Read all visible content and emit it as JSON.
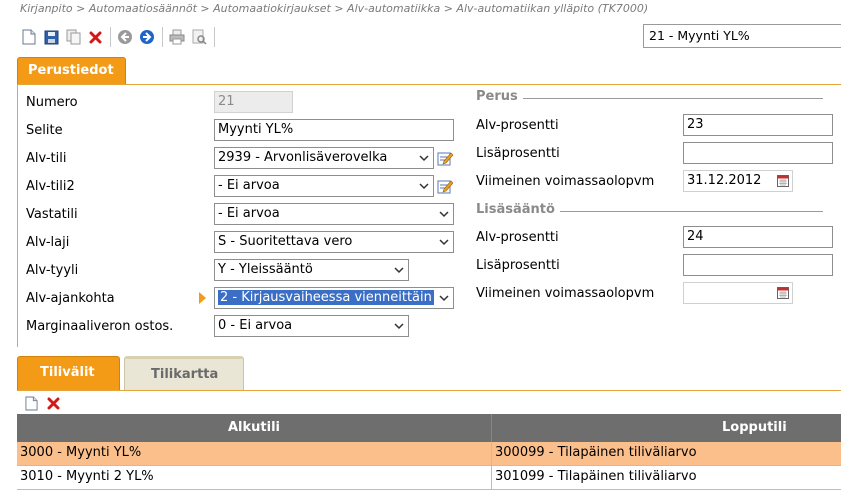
{
  "breadcrumb": "Kirjanpito > Automaatiosäännöt > Automaatiokirjaukset > Alv-automatiikka > Alv-automatiikan ylläpito  (TK7000)",
  "toolbar": {
    "icons": [
      "new-document-icon",
      "save-icon",
      "copy-icon",
      "delete-icon",
      "back-icon",
      "forward-icon",
      "print-icon",
      "print-preview-icon"
    ]
  },
  "record_selector": "21 - Myynti YL%",
  "tabs": {
    "main": "Perustiedot",
    "lower": [
      "Tilivälit",
      "Tilikartta"
    ]
  },
  "form": {
    "numero": {
      "label": "Numero",
      "value": "21"
    },
    "selite": {
      "label": "Selite",
      "value": "Myynti YL%"
    },
    "alv_tili": {
      "label": "Alv-tili",
      "value": "2939 - Arvonlisäverovelka"
    },
    "alv_tili2": {
      "label": "Alv-tili2",
      "value": "-  Ei arvoa"
    },
    "vastatili": {
      "label": "Vastatili",
      "value": "-  Ei arvoa"
    },
    "alv_laji": {
      "label": "Alv-laji",
      "value": "S - Suoritettava vero"
    },
    "alv_tyyli": {
      "label": "Alv-tyyli",
      "value": "Y - Yleissääntö"
    },
    "alv_ajankohta": {
      "label": "Alv-ajankohta",
      "value": "2 - Kirjausvaiheessa vienneittäin"
    },
    "marginaali": {
      "label": "Marginaaliveron ostos.",
      "value": "0 - Ei arvoa"
    }
  },
  "perus": {
    "title": "Perus",
    "alv_prosentti": {
      "label": "Alv-prosentti",
      "value": "23"
    },
    "lisaprosentti": {
      "label": "Lisäprosentti",
      "value": ""
    },
    "voimassaolo": {
      "label": "Viimeinen voimassaolopvm",
      "value": "31.12.2012"
    }
  },
  "lisasaanto": {
    "title": "Lisäsääntö",
    "alv_prosentti": {
      "label": "Alv-prosentti",
      "value": "24"
    },
    "lisaprosentti": {
      "label": "Lisäprosentti",
      "value": ""
    },
    "voimassaolo": {
      "label": "Viimeinen voimassaolopvm",
      "value": ""
    }
  },
  "grid": {
    "columns": [
      "Alkutili",
      "Lopputili"
    ],
    "rows": [
      [
        "3000 - Myynti YL%",
        "300099 - Tilapäinen tiliväliarvo"
      ],
      [
        "3010 - Myynti 2 YL%",
        "301099 - Tilapäinen tiliväliarvo"
      ]
    ]
  },
  "colors": {
    "accent": "#f39a17",
    "header": "#6e6e6e",
    "selected_row": "#fbbf8c"
  }
}
